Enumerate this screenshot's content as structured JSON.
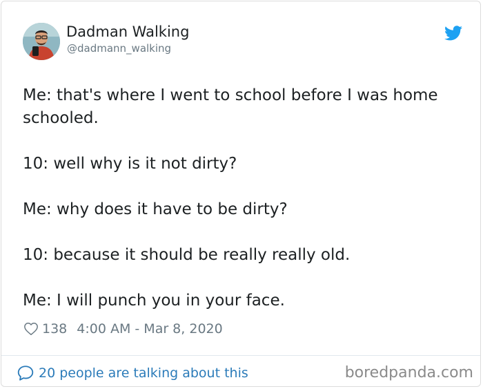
{
  "tweet": {
    "author": {
      "display_name": "Dadman Walking",
      "handle": "@dadmann_walking",
      "avatar_icon": "profile-photo"
    },
    "platform_icon": "twitter-bird-icon",
    "brand_color": "#1da1f2",
    "lines": [
      "Me: that's where I went to school before I was home schooled.",
      "10: well why is it not dirty?",
      "Me: why does it have to be dirty?",
      "10: because it should be really really old.",
      "Me: I will punch you in your face."
    ],
    "meta": {
      "like_icon": "heart-icon",
      "like_count": "138",
      "timestamp": "4:00 AM - Mar 8, 2020"
    },
    "footer": {
      "talk_icon": "speech-bubble-icon",
      "talk_text": "20 people are talking about this",
      "link_color": "#2b7bb9"
    }
  },
  "watermark": "boredpanda.com"
}
